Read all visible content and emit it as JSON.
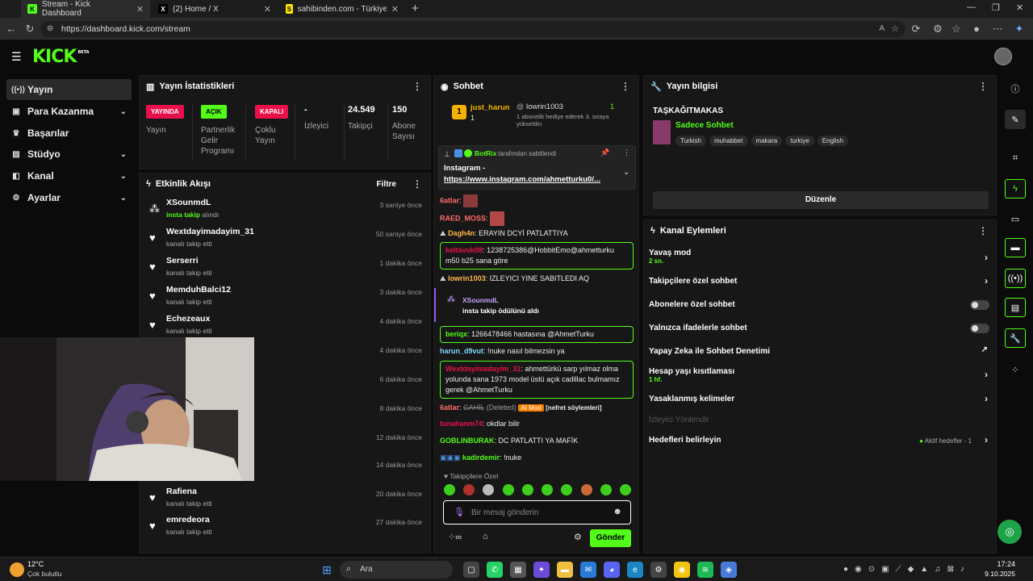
{
  "browser": {
    "tabs": [
      {
        "title": "Stream - Kick Dashboard",
        "icon": "kick-favicon",
        "color": "#53fc18"
      },
      {
        "title": "(2) Home / X",
        "icon": "x-favicon",
        "color": "#000000"
      },
      {
        "title": "sahibinden.com - Türkiye'nin Onl...",
        "icon": "sahibinden-favicon",
        "color": "#ffe800"
      }
    ],
    "url": "https://dashboard.kick.com/stream"
  },
  "kick": {
    "logo": "KICK",
    "beta": "BETA",
    "accent": "#53fc18"
  },
  "sidebar": {
    "items": [
      {
        "label": "Yayın",
        "icon": "broadcast-icon",
        "active": true
      },
      {
        "label": "Para Kazanma",
        "icon": "money-icon",
        "chevron": true
      },
      {
        "label": "Başarılar",
        "icon": "trophy-icon"
      },
      {
        "label": "Stüdyo",
        "icon": "studio-icon",
        "chevron": true
      },
      {
        "label": "Kanal",
        "icon": "channel-icon",
        "chevron": true
      },
      {
        "label": "Ayarlar",
        "icon": "settings-icon",
        "chevron": true
      }
    ]
  },
  "stats": {
    "title": "Yayın İstatistikleri",
    "items": [
      {
        "badge": "YAYINDA",
        "badge_color": "#e8104b",
        "label": "Yayın"
      },
      {
        "badge": "AÇIK",
        "badge_color": "#53fc18",
        "label": "Partnerlik Gelir Programı"
      },
      {
        "badge": "KAPALI",
        "badge_color": "#e8104b",
        "label": "Çoklu Yayın"
      },
      {
        "value": "-",
        "label": "İzleyici"
      },
      {
        "value": "24.549",
        "label": "Takipçi"
      },
      {
        "value": "150",
        "label": "Abone Sayısı"
      }
    ]
  },
  "activity": {
    "title": "Etkinlik Akışı",
    "filter": "Filtre",
    "events": [
      {
        "name": "XSounmdL",
        "desc_prefix": "insta takip",
        "desc": " alındı",
        "time": "3 saniye önce",
        "icon": "reward-icon"
      },
      {
        "name": "Wextdayimadayim_31",
        "desc": "kanalı takip etti",
        "time": "50 saniye önce",
        "icon": "heart-icon"
      },
      {
        "name": "Serserri",
        "desc": "kanalı takip etti",
        "time": "1 dakika önce",
        "icon": "heart-icon"
      },
      {
        "name": "MemduhBalci12",
        "desc": "kanalı takip etti",
        "time": "3 dakika önce",
        "icon": "heart-icon"
      },
      {
        "name": "Echezeaux",
        "desc": "kanalı takip etti",
        "time": "4 dakika önce",
        "icon": "heart-icon"
      },
      {
        "name": "",
        "desc": "",
        "time": "4 dakika önce",
        "icon": "heart-icon"
      },
      {
        "name": "",
        "desc": "",
        "time": "6 dakika önce",
        "icon": "heart-icon"
      },
      {
        "name": "",
        "desc": "",
        "time": "8 dakika önce",
        "icon": "heart-icon"
      },
      {
        "name": "",
        "desc": "",
        "time": "12 dakika önce",
        "icon": "heart-icon"
      },
      {
        "name": "",
        "desc": "",
        "time": "14 dakika önce",
        "icon": "heart-icon"
      },
      {
        "name": "Rafiena",
        "desc": "kanalı takip etti",
        "time": "20 dakika önce",
        "icon": "heart-icon"
      },
      {
        "name": "emredeora",
        "desc": "kanalı takip etti",
        "time": "27 dakika önce",
        "icon": "heart-icon"
      }
    ]
  },
  "chat": {
    "title": "Sohbet",
    "leaderboard": [
      {
        "user": "just_harun",
        "count": "1",
        "rank": "1"
      },
      {
        "user": "lowrin1003",
        "count": "1"
      }
    ],
    "gift_text": "1 abonelik hediye ederek 3. sıraya yükseldin",
    "pinned": {
      "by": "BotRix",
      "by_suffix": "tarafından sabitlendi",
      "title": "Instagram -",
      "link": "https://www.instagram.com/ahmetturku0/..."
    },
    "messages": [
      {
        "user": "6atlar",
        "text": "",
        "color": "#ff6b6b"
      },
      {
        "user": "RAED_MOSS",
        "text": "",
        "color": "#ff6b6b"
      },
      {
        "user": "Dagh4n",
        "text": "ERAYIN DCYİ PATLATTIYA",
        "color": "#ffb74d"
      },
      {
        "user": "keltavuk08",
        "text": "1238725386@HobbitEmo@ahmetturku m50 b25 sana göre",
        "color": "#e8104b",
        "highlight": true
      },
      {
        "user": "lowrin1003",
        "text": "IZLEYICI YINE SABITLEDI AQ",
        "color": "#ffb74d"
      },
      {
        "user": "beriqx",
        "text": "1266478466 hastasına @AhmetTurku",
        "color": "#53fc18",
        "highlight": true
      },
      {
        "user": "harun_d9vut",
        "text": "!nuke nasıl bilmezsin ya",
        "color": "#7fd7ff"
      },
      {
        "user": "Wextdayimadayim_31",
        "text": "ahmettürkü sarp yılmaz olma yolunda sana 1973 model üstü açık cadillac bulmamız gerek @AhmetTurku",
        "color": "#e8104b",
        "highlight": true
      },
      {
        "user": "6atlar",
        "text": "",
        "deleted_word": "CAHİL",
        "deleted": "(Deleted)",
        "mod": "AI Mod",
        "reason": "[nefret söylemleri]",
        "color": "#ff6b6b"
      },
      {
        "user": "tunahanm74",
        "text": "okdlar bilir",
        "color": "#e8104b"
      },
      {
        "user": "GOBLINBURAK",
        "text": "DC PATLATTI YA MAFİK",
        "color": "#53fc18"
      },
      {
        "user": "kadirdemir",
        "text": "!nuke",
        "color": "#53fc18"
      }
    ],
    "reward": {
      "user": "XSounmdL",
      "text": "insta takip ödülünü aldı"
    },
    "followers_only": "Takipçilere Özel",
    "input_placeholder": "Bir mesaj gönderin",
    "send": "Gönder"
  },
  "stream_info": {
    "title": "Yayın bilgisi",
    "stream_title": "TAŞKAĞITMAKAS",
    "category": "Sadece Sohbet",
    "tags": [
      "Turkish",
      "muhabbet",
      "makara",
      "turkiye",
      "English"
    ],
    "edit": "Düzenle"
  },
  "channel_actions": {
    "title": "Kanal Eylemleri",
    "items": [
      {
        "label": "Yavaş mod",
        "sub": "2 sn.",
        "type": "arrow"
      },
      {
        "label": "Takipçilere özel sohbet",
        "type": "arrow"
      },
      {
        "label": "Abonelere özel sohbet",
        "type": "toggle"
      },
      {
        "label": "Yalnızca ifadelerle sohbet",
        "type": "toggle"
      },
      {
        "label": "Yapay Zeka ile Sohbet Denetimi",
        "type": "external"
      },
      {
        "label": "Hesap yaşı kısıtlaması",
        "sub": "1 hf.",
        "type": "arrow"
      },
      {
        "label": "Yasaklanmış kelimeler",
        "type": "arrow"
      },
      {
        "label": "İzleyici Yönlendir",
        "type": "disabled"
      },
      {
        "label": "Hedefleri belirleyin",
        "status": "Aktif hedefler - 1",
        "type": "arrow"
      }
    ]
  },
  "taskbar": {
    "weather_temp": "12°C",
    "weather_desc": "Çok bulutlu",
    "search": "Ara",
    "time": "17:24",
    "date": "9.10.2025"
  }
}
